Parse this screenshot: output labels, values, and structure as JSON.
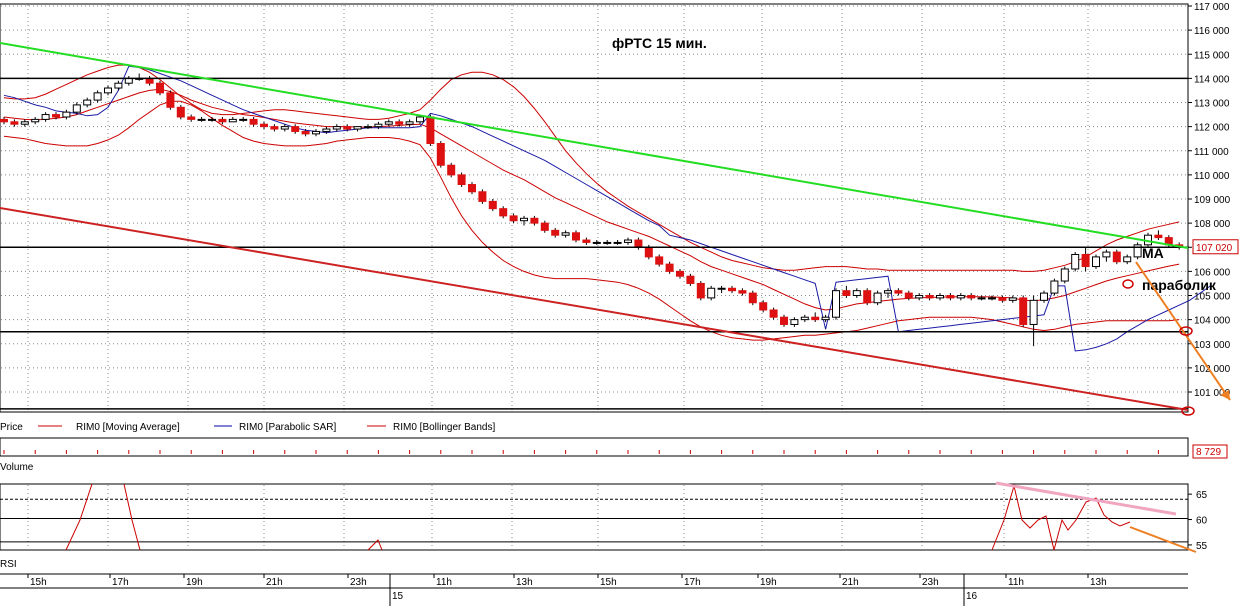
{
  "chart_data": [
    {
      "type": "candlestick",
      "title": "фРТС   15 мин.",
      "price_axis": {
        "ticks": [
          "117 000",
          "116 000",
          "115 000",
          "114 000",
          "113 000",
          "112 000",
          "111 000",
          "110 000",
          "109 000",
          "108 000",
          "107 000",
          "106 000",
          "105 000",
          "104 000",
          "103 000",
          "102 000",
          "101 000"
        ],
        "range": [
          100300,
          117000
        ],
        "last_price_label": "107 020",
        "last_price": 107020
      },
      "legend": {
        "price": "Price",
        "ma": "RIM0 [Moving Average]",
        "sar": "RIM0 [Parabolic SAR]",
        "bb": "RIM0 [Bollinger Bands]"
      },
      "horizontal_levels": [
        114000,
        107000,
        103500,
        100300
      ],
      "annotations": {
        "ma": "MA",
        "sar": "параболик"
      },
      "candles": [
        [
          112300,
          112400,
          112100,
          112200
        ],
        [
          112200,
          112300,
          112000,
          112100
        ],
        [
          112100,
          112300,
          112000,
          112200
        ],
        [
          112200,
          112400,
          112100,
          112300
        ],
        [
          112300,
          112600,
          112200,
          112500
        ],
        [
          112500,
          112600,
          112300,
          112400
        ],
        [
          112400,
          112700,
          112300,
          112600
        ],
        [
          112600,
          113000,
          112500,
          112900
        ],
        [
          112900,
          113200,
          112800,
          113100
        ],
        [
          113100,
          113500,
          113000,
          113400
        ],
        [
          113400,
          113700,
          113300,
          113600
        ],
        [
          113600,
          113900,
          113500,
          113800
        ],
        [
          113800,
          114100,
          113700,
          114000
        ],
        [
          114000,
          114200,
          113900,
          114000
        ],
        [
          114000,
          114100,
          113700,
          113800
        ],
        [
          113800,
          113900,
          113300,
          113400
        ],
        [
          113400,
          113500,
          112700,
          112800
        ],
        [
          112800,
          112900,
          112300,
          112400
        ],
        [
          112400,
          112500,
          112200,
          112300
        ],
        [
          112300,
          112400,
          112200,
          112300
        ],
        [
          112300,
          112400,
          112200,
          112300
        ],
        [
          112300,
          112400,
          112100,
          112200
        ],
        [
          112200,
          112400,
          112200,
          112300
        ],
        [
          112300,
          112400,
          112200,
          112300
        ],
        [
          112300,
          112400,
          112000,
          112100
        ],
        [
          112100,
          112200,
          111900,
          112000
        ],
        [
          112000,
          112100,
          111800,
          111900
        ],
        [
          111900,
          112100,
          111800,
          112000
        ],
        [
          112000,
          112100,
          111700,
          111800
        ],
        [
          111800,
          111900,
          111600,
          111700
        ],
        [
          111700,
          111900,
          111600,
          111800
        ],
        [
          111800,
          112000,
          111700,
          111900
        ],
        [
          111900,
          112100,
          111800,
          112000
        ],
        [
          112000,
          112100,
          111800,
          111900
        ],
        [
          111900,
          112000,
          111800,
          112000
        ],
        [
          112000,
          112100,
          111900,
          112000
        ],
        [
          112000,
          112200,
          111900,
          112100
        ],
        [
          112100,
          112300,
          112000,
          112200
        ],
        [
          112200,
          112300,
          112000,
          112100
        ],
        [
          112100,
          112300,
          112000,
          112200
        ],
        [
          112200,
          112500,
          112100,
          112400
        ],
        [
          112400,
          112500,
          111200,
          111300
        ],
        [
          111300,
          111400,
          110300,
          110400
        ],
        [
          110400,
          110500,
          109900,
          110000
        ],
        [
          110000,
          110100,
          109500,
          109600
        ],
        [
          109600,
          109700,
          109200,
          109300
        ],
        [
          109300,
          109400,
          108800,
          108900
        ],
        [
          108900,
          109000,
          108500,
          108600
        ],
        [
          108600,
          108700,
          108200,
          108300
        ],
        [
          108300,
          108400,
          108000,
          108100
        ],
        [
          108100,
          108300,
          107900,
          108200
        ],
        [
          108200,
          108300,
          107900,
          108000
        ],
        [
          108000,
          108100,
          107600,
          107700
        ],
        [
          107700,
          107800,
          107400,
          107500
        ],
        [
          107500,
          107700,
          107400,
          107600
        ],
        [
          107600,
          107700,
          107200,
          107300
        ],
        [
          107300,
          107400,
          107100,
          107200
        ],
        [
          107200,
          107300,
          107100,
          107200
        ],
        [
          107200,
          107300,
          107100,
          107200
        ],
        [
          107200,
          107300,
          107100,
          107200
        ],
        [
          107200,
          107400,
          107100,
          107300
        ],
        [
          107300,
          107400,
          106900,
          107000
        ],
        [
          107000,
          107100,
          106500,
          106600
        ],
        [
          106600,
          106700,
          106200,
          106300
        ],
        [
          106300,
          106400,
          105900,
          106000
        ],
        [
          106000,
          106100,
          105700,
          105800
        ],
        [
          105800,
          105900,
          105400,
          105500
        ],
        [
          105500,
          105600,
          104800,
          104900
        ],
        [
          104900,
          105400,
          104800,
          105300
        ],
        [
          105300,
          105400,
          105100,
          105300
        ],
        [
          105300,
          105400,
          105100,
          105200
        ],
        [
          105200,
          105300,
          105000,
          105100
        ],
        [
          105100,
          105200,
          104600,
          104700
        ],
        [
          104700,
          104800,
          104300,
          104400
        ],
        [
          104400,
          104500,
          104000,
          104100
        ],
        [
          104100,
          104200,
          103700,
          103800
        ],
        [
          103800,
          104100,
          103700,
          104000
        ],
        [
          104000,
          104200,
          103900,
          104100
        ],
        [
          104100,
          104300,
          103900,
          104000
        ],
        [
          104000,
          104200,
          103900,
          104100
        ],
        [
          104100,
          105300,
          104000,
          105200
        ],
        [
          105200,
          105400,
          104900,
          105000
        ],
        [
          105000,
          105300,
          104900,
          105200
        ],
        [
          105200,
          105300,
          104600,
          104700
        ],
        [
          104700,
          105200,
          104600,
          105100
        ],
        [
          105100,
          105300,
          104900,
          105200
        ],
        [
          105200,
          105300,
          105000,
          105100
        ],
        [
          105100,
          105200,
          104800,
          104900
        ],
        [
          104900,
          105100,
          104800,
          105000
        ],
        [
          105000,
          105100,
          104800,
          104900
        ],
        [
          104900,
          105100,
          104800,
          105000
        ],
        [
          105000,
          105100,
          104800,
          104900
        ],
        [
          104900,
          105100,
          104800,
          105000
        ],
        [
          105000,
          105100,
          104800,
          104900
        ],
        [
          104900,
          105000,
          104800,
          104900
        ],
        [
          104900,
          105000,
          104800,
          104900
        ],
        [
          104900,
          105000,
          104700,
          104800
        ],
        [
          104800,
          105000,
          104700,
          104900
        ],
        [
          104900,
          105000,
          103700,
          103800
        ],
        [
          103800,
          105000,
          102900,
          104800
        ],
        [
          104800,
          105200,
          104700,
          105100
        ],
        [
          105100,
          105700,
          105000,
          105600
        ],
        [
          105600,
          106200,
          105500,
          106100
        ],
        [
          106100,
          106800,
          106000,
          106700
        ],
        [
          106700,
          107000,
          106000,
          106200
        ],
        [
          106200,
          106700,
          106100,
          106600
        ],
        [
          106600,
          106900,
          106400,
          106800
        ],
        [
          106800,
          106900,
          106300,
          106400
        ],
        [
          106400,
          106700,
          106300,
          106600
        ],
        [
          106600,
          107200,
          106500,
          107100
        ],
        [
          107100,
          107600,
          107000,
          107500
        ],
        [
          107500,
          107700,
          107300,
          107400
        ],
        [
          107400,
          107500,
          107000,
          107100
        ],
        [
          107100,
          107200,
          106900,
          107000
        ]
      ],
      "moving_average": [
        112400,
        112350,
        112300,
        112280,
        112300,
        112350,
        112400,
        112500,
        112650,
        112800,
        112950,
        113100,
        113250,
        113400,
        113500,
        113550,
        113450,
        113300,
        113100,
        112950,
        112800,
        112700,
        112600,
        112500,
        112450,
        112380,
        112300,
        112220,
        112150,
        112100,
        112050,
        112000,
        112000,
        112000,
        111980,
        111980,
        112000,
        112020,
        112050,
        112080,
        112100,
        111950,
        111700,
        111450,
        111200,
        110950,
        110700,
        110450,
        110200,
        110000,
        109800,
        109550,
        109300,
        109050,
        108850,
        108650,
        108450,
        108250,
        108050,
        107900,
        107750,
        107600,
        107450,
        107250,
        107050,
        106850,
        106650,
        106400,
        106200,
        106050,
        105900,
        105750,
        105600,
        105450,
        105250,
        105050,
        104850,
        104650,
        104500,
        104400,
        104450,
        104550,
        104650,
        104700,
        104750,
        104800,
        104850,
        104880,
        104900,
        104920,
        104930,
        104940,
        104950,
        104950,
        104950,
        104940,
        104920,
        104900,
        104800,
        104780,
        104820,
        104900,
        105000,
        105150,
        105300,
        105450,
        105600,
        105720,
        105820,
        105920,
        106020,
        106120,
        106220,
        106300
      ],
      "parabolic_sar": [
        113300,
        113200,
        113050,
        112900,
        112800,
        112650,
        112600,
        112550,
        112450,
        112500,
        112800,
        113500,
        114500,
        114450,
        114350,
        114200,
        114050,
        113900,
        113700,
        113500,
        113300,
        113100,
        112900,
        112700,
        112550,
        112400,
        112250,
        112100,
        111950,
        111850,
        111800,
        111750,
        111800,
        111850,
        111900,
        111950,
        111950,
        111950,
        111950,
        111950,
        112000,
        112550,
        112450,
        112300,
        112150,
        112000,
        111800,
        111600,
        111400,
        111200,
        111000,
        110800,
        110600,
        110350,
        110100,
        109850,
        109600,
        109350,
        109100,
        108850,
        108600,
        108350,
        108100,
        107900,
        107500,
        107400,
        107300,
        107150,
        107000,
        106850,
        106700,
        106550,
        106400,
        106250,
        106100,
        105950,
        105800,
        105650,
        105500,
        103600,
        105550,
        105600,
        105650,
        105700,
        105750,
        105800,
        103500,
        103550,
        103600,
        103650,
        103700,
        103750,
        103800,
        103850,
        103900,
        103950,
        104000,
        104050,
        104100,
        104150,
        104200,
        105400,
        105400,
        102700,
        102750,
        102850,
        103000,
        103200,
        103500,
        103750,
        104000,
        104200,
        104400,
        104600,
        104800,
        105100,
        105400
      ],
      "bollinger_upper": [
        113200,
        113150,
        113150,
        113200,
        113350,
        113550,
        113750,
        113950,
        114150,
        114300,
        114450,
        114550,
        114550,
        114450,
        114250,
        113950,
        113600,
        113250,
        112950,
        112700,
        112550,
        112500,
        112500,
        112550,
        112600,
        112650,
        112700,
        112700,
        112650,
        112600,
        112550,
        112500,
        112450,
        112400,
        112350,
        112300,
        112300,
        112350,
        112450,
        112550,
        112700,
        113100,
        113550,
        113950,
        114150,
        114250,
        114250,
        114150,
        113950,
        113650,
        113250,
        112750,
        112200,
        111600,
        111000,
        110500,
        110050,
        109650,
        109300,
        109000,
        108700,
        108450,
        108200,
        107950,
        107700,
        107450,
        107200,
        107000,
        106800,
        106600,
        106450,
        106350,
        106250,
        106150,
        106100,
        106050,
        106050,
        106100,
        106150,
        106200,
        106200,
        106200,
        106150,
        106100,
        106100,
        106050,
        106050,
        106050,
        106050,
        106050,
        106050,
        106050,
        106050,
        106050,
        106050,
        106050,
        106050,
        106050,
        106000,
        106000,
        106050,
        106150,
        106250,
        106400,
        106600,
        106850,
        107100,
        107300,
        107450,
        107600,
        107750,
        107850,
        107950,
        108050
      ],
      "bollinger_lower": [
        111600,
        111550,
        111500,
        111400,
        111300,
        111250,
        111200,
        111200,
        111200,
        111300,
        111450,
        111650,
        111950,
        112300,
        112600,
        112900,
        113050,
        113050,
        112900,
        112650,
        112350,
        112050,
        111800,
        111550,
        111400,
        111300,
        111250,
        111200,
        111200,
        111200,
        111250,
        111300,
        111400,
        111450,
        111500,
        111550,
        111550,
        111550,
        111500,
        111400,
        111250,
        110700,
        109900,
        109050,
        108300,
        107700,
        107200,
        106800,
        106450,
        106200,
        106000,
        105850,
        105750,
        105700,
        105700,
        105700,
        105700,
        105650,
        105600,
        105550,
        105450,
        105300,
        105100,
        104850,
        104550,
        104250,
        103950,
        103700,
        103500,
        103350,
        103250,
        103200,
        103150,
        103150,
        103200,
        103250,
        103300,
        103350,
        103350,
        103400,
        103450,
        103500,
        103550,
        103650,
        103750,
        103850,
        103950,
        104000,
        104050,
        104100,
        104100,
        104100,
        104100,
        104100,
        104050,
        104000,
        103900,
        103800,
        103700,
        103600,
        103550,
        103600,
        103700,
        103800,
        103850,
        103900,
        103950,
        103950,
        103950,
        103950,
        103950,
        103950,
        103950,
        104000
      ],
      "volume": {
        "label": "Volume",
        "last_label": "8 729",
        "last_value": 8729
      },
      "rsi": {
        "label": "RSI",
        "ticks": [
          "65",
          "60",
          "55"
        ],
        "range": [
          54,
          67
        ],
        "levels": [
          64,
          60.2,
          55.6
        ]
      },
      "time_axis": {
        "labels": [
          "15h",
          "17h",
          "19h",
          "21h",
          "23h",
          "15",
          "11h",
          "13h",
          "15h",
          "17h",
          "19h",
          "21h",
          "23h",
          "16",
          "11h",
          "13h"
        ],
        "date_labels": [
          "15",
          "16"
        ]
      }
    }
  ]
}
